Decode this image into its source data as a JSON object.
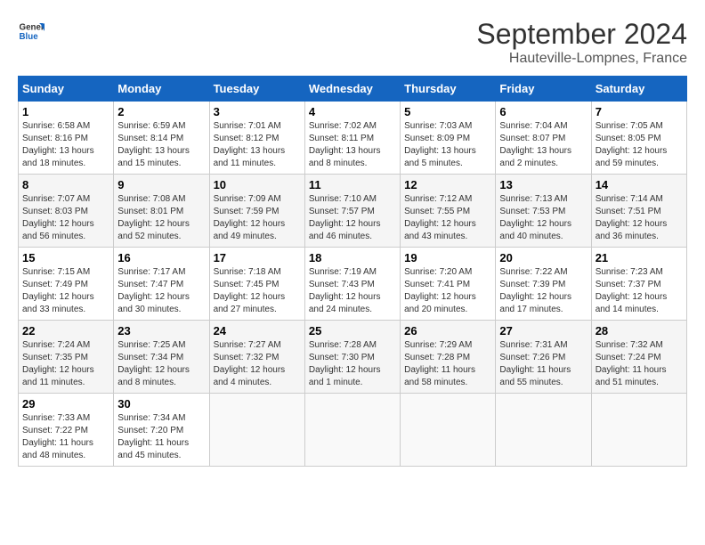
{
  "logo": {
    "general": "General",
    "blue": "Blue"
  },
  "header": {
    "month": "September 2024",
    "location": "Hauteville-Lompnes, France"
  },
  "weekdays": [
    "Sunday",
    "Monday",
    "Tuesday",
    "Wednesday",
    "Thursday",
    "Friday",
    "Saturday"
  ],
  "weeks": [
    [
      {
        "day": "1",
        "sunrise": "Sunrise: 6:58 AM",
        "sunset": "Sunset: 8:16 PM",
        "daylight": "Daylight: 13 hours and 18 minutes."
      },
      {
        "day": "2",
        "sunrise": "Sunrise: 6:59 AM",
        "sunset": "Sunset: 8:14 PM",
        "daylight": "Daylight: 13 hours and 15 minutes."
      },
      {
        "day": "3",
        "sunrise": "Sunrise: 7:01 AM",
        "sunset": "Sunset: 8:12 PM",
        "daylight": "Daylight: 13 hours and 11 minutes."
      },
      {
        "day": "4",
        "sunrise": "Sunrise: 7:02 AM",
        "sunset": "Sunset: 8:11 PM",
        "daylight": "Daylight: 13 hours and 8 minutes."
      },
      {
        "day": "5",
        "sunrise": "Sunrise: 7:03 AM",
        "sunset": "Sunset: 8:09 PM",
        "daylight": "Daylight: 13 hours and 5 minutes."
      },
      {
        "day": "6",
        "sunrise": "Sunrise: 7:04 AM",
        "sunset": "Sunset: 8:07 PM",
        "daylight": "Daylight: 13 hours and 2 minutes."
      },
      {
        "day": "7",
        "sunrise": "Sunrise: 7:05 AM",
        "sunset": "Sunset: 8:05 PM",
        "daylight": "Daylight: 12 hours and 59 minutes."
      }
    ],
    [
      {
        "day": "8",
        "sunrise": "Sunrise: 7:07 AM",
        "sunset": "Sunset: 8:03 PM",
        "daylight": "Daylight: 12 hours and 56 minutes."
      },
      {
        "day": "9",
        "sunrise": "Sunrise: 7:08 AM",
        "sunset": "Sunset: 8:01 PM",
        "daylight": "Daylight: 12 hours and 52 minutes."
      },
      {
        "day": "10",
        "sunrise": "Sunrise: 7:09 AM",
        "sunset": "Sunset: 7:59 PM",
        "daylight": "Daylight: 12 hours and 49 minutes."
      },
      {
        "day": "11",
        "sunrise": "Sunrise: 7:10 AM",
        "sunset": "Sunset: 7:57 PM",
        "daylight": "Daylight: 12 hours and 46 minutes."
      },
      {
        "day": "12",
        "sunrise": "Sunrise: 7:12 AM",
        "sunset": "Sunset: 7:55 PM",
        "daylight": "Daylight: 12 hours and 43 minutes."
      },
      {
        "day": "13",
        "sunrise": "Sunrise: 7:13 AM",
        "sunset": "Sunset: 7:53 PM",
        "daylight": "Daylight: 12 hours and 40 minutes."
      },
      {
        "day": "14",
        "sunrise": "Sunrise: 7:14 AM",
        "sunset": "Sunset: 7:51 PM",
        "daylight": "Daylight: 12 hours and 36 minutes."
      }
    ],
    [
      {
        "day": "15",
        "sunrise": "Sunrise: 7:15 AM",
        "sunset": "Sunset: 7:49 PM",
        "daylight": "Daylight: 12 hours and 33 minutes."
      },
      {
        "day": "16",
        "sunrise": "Sunrise: 7:17 AM",
        "sunset": "Sunset: 7:47 PM",
        "daylight": "Daylight: 12 hours and 30 minutes."
      },
      {
        "day": "17",
        "sunrise": "Sunrise: 7:18 AM",
        "sunset": "Sunset: 7:45 PM",
        "daylight": "Daylight: 12 hours and 27 minutes."
      },
      {
        "day": "18",
        "sunrise": "Sunrise: 7:19 AM",
        "sunset": "Sunset: 7:43 PM",
        "daylight": "Daylight: 12 hours and 24 minutes."
      },
      {
        "day": "19",
        "sunrise": "Sunrise: 7:20 AM",
        "sunset": "Sunset: 7:41 PM",
        "daylight": "Daylight: 12 hours and 20 minutes."
      },
      {
        "day": "20",
        "sunrise": "Sunrise: 7:22 AM",
        "sunset": "Sunset: 7:39 PM",
        "daylight": "Daylight: 12 hours and 17 minutes."
      },
      {
        "day": "21",
        "sunrise": "Sunrise: 7:23 AM",
        "sunset": "Sunset: 7:37 PM",
        "daylight": "Daylight: 12 hours and 14 minutes."
      }
    ],
    [
      {
        "day": "22",
        "sunrise": "Sunrise: 7:24 AM",
        "sunset": "Sunset: 7:35 PM",
        "daylight": "Daylight: 12 hours and 11 minutes."
      },
      {
        "day": "23",
        "sunrise": "Sunrise: 7:25 AM",
        "sunset": "Sunset: 7:34 PM",
        "daylight": "Daylight: 12 hours and 8 minutes."
      },
      {
        "day": "24",
        "sunrise": "Sunrise: 7:27 AM",
        "sunset": "Sunset: 7:32 PM",
        "daylight": "Daylight: 12 hours and 4 minutes."
      },
      {
        "day": "25",
        "sunrise": "Sunrise: 7:28 AM",
        "sunset": "Sunset: 7:30 PM",
        "daylight": "Daylight: 12 hours and 1 minute."
      },
      {
        "day": "26",
        "sunrise": "Sunrise: 7:29 AM",
        "sunset": "Sunset: 7:28 PM",
        "daylight": "Daylight: 11 hours and 58 minutes."
      },
      {
        "day": "27",
        "sunrise": "Sunrise: 7:31 AM",
        "sunset": "Sunset: 7:26 PM",
        "daylight": "Daylight: 11 hours and 55 minutes."
      },
      {
        "day": "28",
        "sunrise": "Sunrise: 7:32 AM",
        "sunset": "Sunset: 7:24 PM",
        "daylight": "Daylight: 11 hours and 51 minutes."
      }
    ],
    [
      {
        "day": "29",
        "sunrise": "Sunrise: 7:33 AM",
        "sunset": "Sunset: 7:22 PM",
        "daylight": "Daylight: 11 hours and 48 minutes."
      },
      {
        "day": "30",
        "sunrise": "Sunrise: 7:34 AM",
        "sunset": "Sunset: 7:20 PM",
        "daylight": "Daylight: 11 hours and 45 minutes."
      },
      null,
      null,
      null,
      null,
      null
    ]
  ]
}
